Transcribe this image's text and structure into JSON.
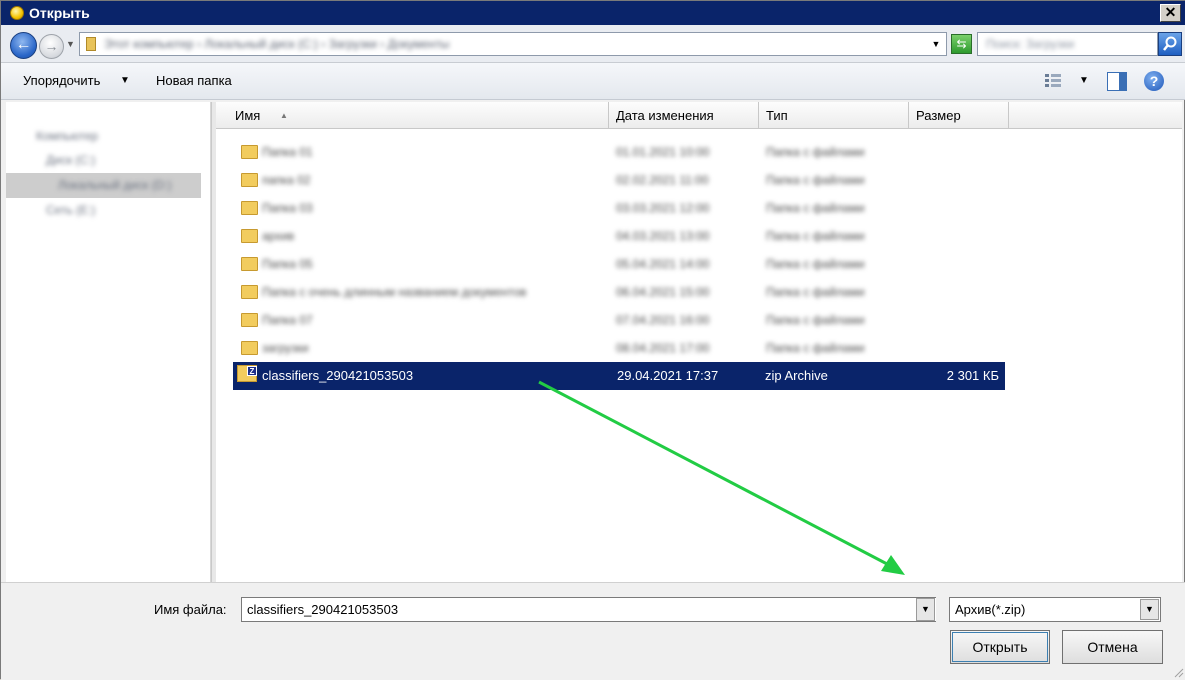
{
  "window": {
    "title": "Открыть",
    "close_label": "✕"
  },
  "address": {
    "path_text": "Этот компьютер › Локальный диск (C:) › Загрузки › Документы",
    "search_placeholder": "Поиск: Загрузки"
  },
  "toolbar": {
    "organize_label": "Упорядочить",
    "new_folder_label": "Новая папка"
  },
  "nav": {
    "items": [
      "Компьютер",
      "Диск (C:)",
      "Локальный диск (D:)",
      "Сеть (E:)"
    ]
  },
  "columns": {
    "name": "Имя",
    "date": "Дата изменения",
    "type": "Тип",
    "size": "Размер"
  },
  "folders": [
    {
      "name": "Папка 01",
      "date": "01.01.2021 10:00",
      "type": "Папка с файлами"
    },
    {
      "name": "папка 02",
      "date": "02.02.2021 11:00",
      "type": "Папка с файлами"
    },
    {
      "name": "Папка 03",
      "date": "03.03.2021 12:00",
      "type": "Папка с файлами"
    },
    {
      "name": "архив",
      "date": "04.03.2021 13:00",
      "type": "Папка с файлами"
    },
    {
      "name": "Папка 05",
      "date": "05.04.2021 14:00",
      "type": "Папка с файлами"
    },
    {
      "name": "Папка с очень длинным названием документов",
      "date": "06.04.2021 15:00",
      "type": "Папка с файлами"
    },
    {
      "name": "Папка 07",
      "date": "07.04.2021 16:00",
      "type": "Папка с файлами"
    },
    {
      "name": "загрузки",
      "date": "08.04.2021 17:00",
      "type": "Папка с файлами"
    }
  ],
  "selected_file": {
    "name": "classifiers_290421053503",
    "date": "29.04.2021 17:37",
    "type": "zip Archive",
    "size": "2 301 КБ",
    "icon": "zip-archive-icon"
  },
  "footer": {
    "filename_label": "Имя файла:",
    "filename_value": "classifiers_290421053503",
    "filter_value": "Архив(*.zip)",
    "open_label": "Открыть",
    "cancel_label": "Отмена"
  },
  "colors": {
    "selection": "#0a246a",
    "arrow": "#22cc44"
  }
}
